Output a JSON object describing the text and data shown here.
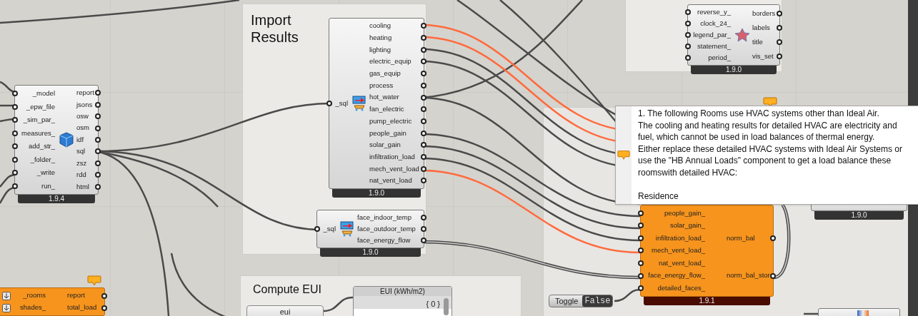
{
  "groups": [
    {
      "title": "Import Results"
    },
    {
      "title": "Compute EUI"
    }
  ],
  "components": [
    {
      "warning": false,
      "flattened": false,
      "inputs": [
        "_model",
        "_epw_file",
        "_sim_par_",
        "measures_",
        "add_str_",
        "_folder_",
        "_write",
        "run_"
      ],
      "outputs": [
        "report",
        "jsons",
        "osw",
        "osm",
        "idf",
        "sql",
        "zsz",
        "rdd",
        "html"
      ],
      "version": "1.9.4"
    },
    {
      "warning": false,
      "flattened": false,
      "inputs": [
        "_sql"
      ],
      "outputs": [
        "cooling",
        "heating",
        "lighting",
        "electric_equip",
        "gas_equip",
        "process",
        "hot_water",
        "fan_electric",
        "pump_electric",
        "people_gain",
        "solar_gain",
        "infiltration_load",
        "mech_vent_load",
        "nat_vent_load"
      ],
      "version": "1.9.0"
    },
    {
      "warning": false,
      "flattened": false,
      "inputs": [
        "_sql"
      ],
      "outputs": [
        "face_indoor_temp",
        "face_outdoor_temp",
        "face_energy_flow"
      ],
      "version": "1.9.0"
    },
    {
      "warning": false,
      "flattened": false,
      "inputs": [
        "reverse_y_",
        "clock_24_",
        "legend_par_",
        "statement_",
        "period_"
      ],
      "outputs": [
        "borders",
        "labels",
        "title",
        "vis_set"
      ],
      "version": "1.9.0"
    },
    {
      "warning": true,
      "flattened": false,
      "inputs": [
        "people_gain_",
        "solar_gain_",
        "infiltration_load_",
        "mech_vent_load_",
        "nat_vent_load_",
        "face_energy_flow_",
        "detailed_faces_"
      ],
      "outputs": [
        "norm_bal",
        "norm_bal_stor"
      ],
      "version": "1.9.1"
    },
    {
      "warning": false,
      "version": "1.9.0"
    },
    {
      "warning": true,
      "flattened": true,
      "inputs": [
        "_rooms",
        "shades_"
      ],
      "outputs": [
        "report",
        "total_load"
      ]
    },
    {
      "warning": false
    }
  ],
  "tooltip": {
    "message": [
      "1. The following Rooms use HVAC systems other than Ideal Air.",
      "The cooling and heating results for detailed HVAC are electricity and",
      "fuel, which cannot be used in load balances of thermal energy.",
      "Either replace these detailed HVAC systems with Ideal Air Systems or",
      "use the \"HB Annual Loads\" component to get a load balance these",
      "roomswith detailed HVAC:"
    ],
    "item": "Residence"
  },
  "toggle": {
    "label": "Toggle",
    "value": "False",
    "on": false
  },
  "button": {
    "label": "eui"
  },
  "panel": {
    "title": "EUI (kWh/m2)",
    "path": "{ 0 }"
  }
}
